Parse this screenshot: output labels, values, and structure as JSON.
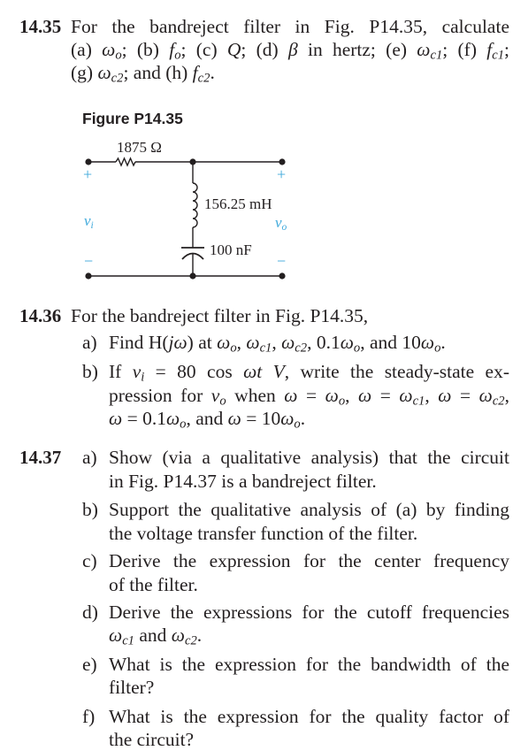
{
  "problems": [
    {
      "number": "14.35",
      "lines": [
        "For the bandreject filter in Fig. P14.35, calculate",
        "(a) ω_o; (b) f_o; (c) Q; (d) β in hertz; (e) ω_c1; (f) f_c1;",
        "(g) ω_c2; and (h) f_c2."
      ],
      "text_parts": {
        "l1": "For the bandreject filter in Fig. P14.35, calculate",
        "l2_a": "(a) ",
        "l2_b": "; (b) ",
        "l2_c": "; (c) ",
        "l2_d": "; (d) ",
        "l2_e": " in hertz; (e) ",
        "l2_f": "; (f) ",
        "l2_end": ";",
        "l3_g": "(g) ",
        "l3_h": "; and (h) ",
        "l3_end": "."
      }
    },
    {
      "number": "14.36",
      "intro": "For the bandreject filter in Fig. P14.35,",
      "items": [
        {
          "label": "a)",
          "text": "Find H(jω) at ω_o, ω_c1, ω_c2, 0.1ω_o, and 10ω_o."
        },
        {
          "label": "b)",
          "text": "If v_i = 80 cos ωt V, write the steady-state expression for v_o when ω = ω_o, ω = ω_c1, ω = ω_c2, ω = 0.1ω_o, and ω = 10ω_o."
        }
      ]
    },
    {
      "number": "14.37",
      "items": [
        {
          "label": "a)",
          "lines": [
            "Show (via a qualitative analysis) that the circuit",
            "in Fig. P14.37 is a bandreject filter."
          ]
        },
        {
          "label": "b)",
          "lines": [
            "Support the qualitative analysis of (a) by finding",
            "the voltage transfer function of the filter."
          ]
        },
        {
          "label": "c)",
          "lines": [
            "Derive the expression for the center frequency",
            "of the filter."
          ]
        },
        {
          "label": "d)",
          "lines": [
            "Derive the expressions for the cutoff frequencies",
            "ω_c1 and ω_c2."
          ]
        },
        {
          "label": "e)",
          "lines": [
            "What is the expression for the bandwidth of the",
            "filter?"
          ]
        },
        {
          "label": "f)",
          "lines": [
            "What is the expression for the quality factor of",
            "the circuit?"
          ]
        }
      ]
    }
  ],
  "figure": {
    "title": "Figure P14.35",
    "resistor": "1875 Ω",
    "inductor": "156.25 mH",
    "capacitor": "100 nF",
    "input_label": "v",
    "input_sub": "i",
    "output_label": "v",
    "output_sub": "o",
    "plus": "+",
    "minus": "−",
    "polarity_color": "#3fa9db",
    "wire_color": "#231f20"
  },
  "symbols": {
    "omega": "ω",
    "f": "f",
    "Q": "Q",
    "beta": "β",
    "o": "o",
    "c1": "c1",
    "c2": "c2",
    "H": "H(",
    "j": "j",
    "close": ")",
    "t": "t",
    "V": "V"
  },
  "p36": {
    "a1": "Find ",
    "a2": " at ",
    "a3": ", ",
    "a4": ", ",
    "a5": ", 0.1",
    "a6": ", and 10",
    "a7": ".",
    "b1": "If ",
    "b2": " = 80 cos ",
    "b3": ", write the steady-state ex-",
    "b4": "pression for ",
    "b5": " when ",
    "eq": " = ",
    "comma": ", ",
    "b6": " = 0.1",
    "b7": ", and ",
    "b8": " = 10",
    "b9": "."
  },
  "p37d": {
    "and": " and ",
    "end": "."
  }
}
